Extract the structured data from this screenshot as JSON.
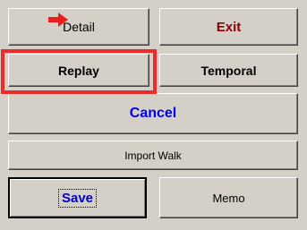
{
  "buttons": {
    "detail": "Detail",
    "exit": "Exit",
    "replay": "Replay",
    "temporal": "Temporal",
    "cancel": "Cancel",
    "import_walk": "Import Walk",
    "save": "Save",
    "memo": "Memo"
  },
  "colors": {
    "panel_bg": "#d4d0c8",
    "exit_text": "#8b0000",
    "cancel_text": "#0000ee",
    "save_text": "#0000cc",
    "highlight": "#ee2a2a",
    "arrow": "#ee1c1c"
  },
  "annotations": {
    "highlighted_button": "replay",
    "cursor_icon": "red-arrow-icon"
  }
}
